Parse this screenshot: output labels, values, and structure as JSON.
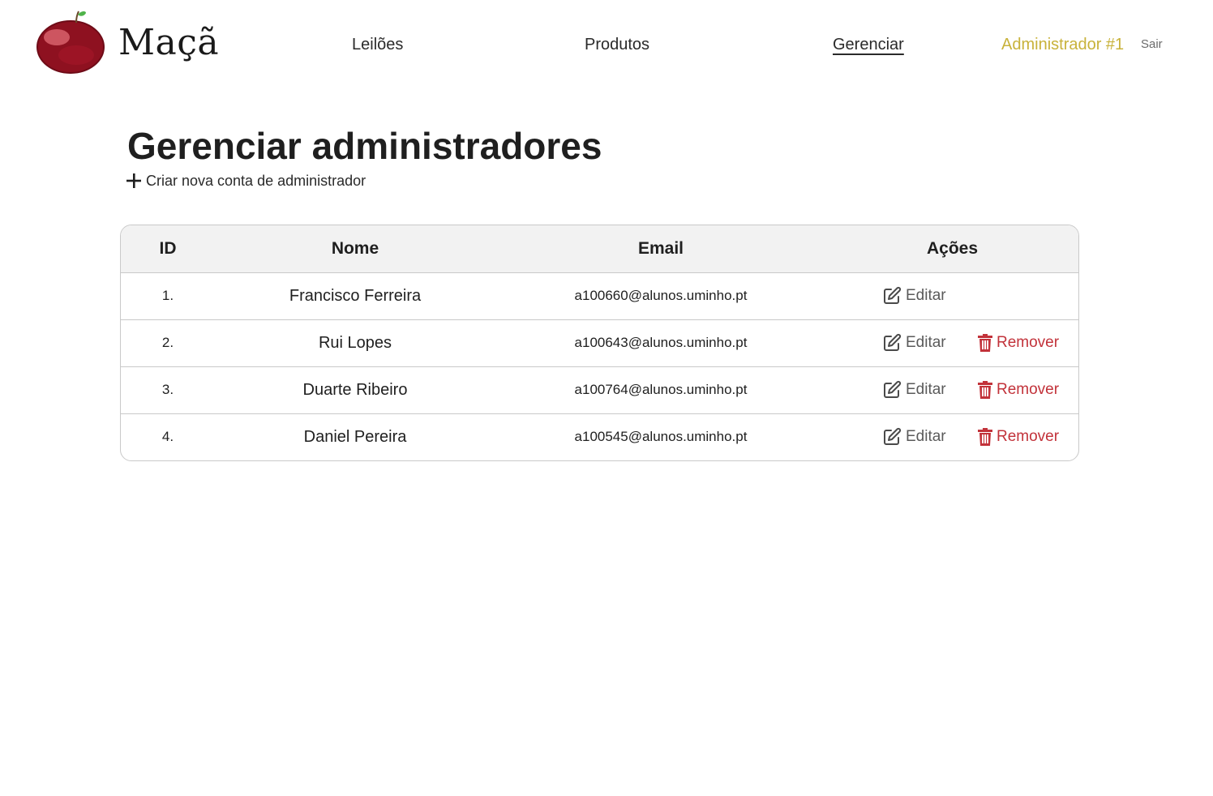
{
  "header": {
    "brand_name": "Maçã",
    "nav": [
      {
        "label": "Leilões"
      },
      {
        "label": "Produtos"
      },
      {
        "label": "Gerenciar",
        "active": true
      }
    ],
    "user_name": "Administrador #1",
    "logout_label": "Sair"
  },
  "page": {
    "title": "Gerenciar administradores",
    "create_label": "Criar nova conta de administrador"
  },
  "table": {
    "headers": [
      "ID",
      "Nome",
      "Email",
      "Ações"
    ],
    "edit_label": "Editar",
    "remove_label": "Remover",
    "rows": [
      {
        "id": "1.",
        "name": "Francisco Ferreira",
        "email": "a100660@alunos.uminho.pt",
        "removable": false
      },
      {
        "id": "2.",
        "name": "Rui Lopes",
        "email": "a100643@alunos.uminho.pt",
        "removable": true
      },
      {
        "id": "3.",
        "name": "Duarte Ribeiro",
        "email": "a100764@alunos.uminho.pt",
        "removable": true
      },
      {
        "id": "4.",
        "name": "Daniel Pereira",
        "email": "a100545@alunos.uminho.pt",
        "removable": true
      }
    ]
  },
  "colors": {
    "user_accent": "#c8b23a",
    "remove_accent": "#c2323a",
    "logo_apple": "#8e1120"
  },
  "icons": {
    "logo": "apple-logo-icon",
    "create": "plus-icon",
    "edit": "edit-icon",
    "remove": "trash-icon"
  }
}
